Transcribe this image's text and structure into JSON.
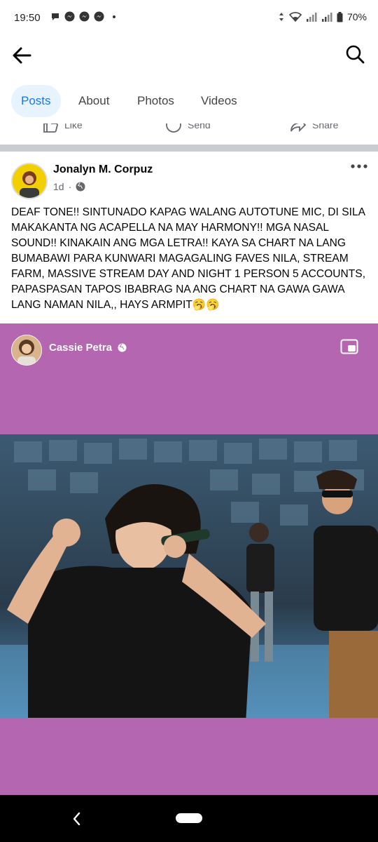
{
  "status_bar": {
    "time": "19:50",
    "battery": "70%",
    "icons": [
      "chat-bubble-icon",
      "messenger-icon",
      "messenger-icon",
      "messenger-icon",
      "dot-icon",
      "data-arrows-icon",
      "wifi-icon",
      "signal-icon",
      "signal-icon",
      "battery-icon"
    ]
  },
  "appbar": {
    "back_icon": "arrow-left-icon",
    "search_icon": "search-icon"
  },
  "tabs": [
    {
      "label": "Posts",
      "active": true
    },
    {
      "label": "About",
      "active": false
    },
    {
      "label": "Photos",
      "active": false
    },
    {
      "label": "Videos",
      "active": false
    }
  ],
  "actions": {
    "like": "Like",
    "send": "Send",
    "share": "Share"
  },
  "post": {
    "author": "Jonalyn M. Corpuz",
    "time": "1d",
    "audience_icon": "globe-icon",
    "text": "DEAF TONE!! SINTUNADO KAPAG WALANG AUTOTUNE MIC, DI SILA MAKAKANTA NG ACAPELLA NA MAY HARMONY!! MGA NASAL SOUND!! KINAKAIN ANG MGA LETRA!! KAYA SA CHART NA LANG BUMABAWI PARA KUNWARI MAGAGALING FAVES NILA, STREAM FARM, MASSIVE STREAM DAY AND NIGHT 1 PERSON 5 ACCOUNTS, PAPASPASAN TAPOS IBABRAG NA ANG CHART NA GAWA GAWA LANG NAMAN NILA,, HAYS ARMPIT🥱🥱"
  },
  "shared_post": {
    "author": "Cassie Petra",
    "audience_icon": "globe-icon",
    "background": "#b566b1"
  },
  "colors": {
    "accent": "#1877f2",
    "tab_active_bg": "#e7f3ff",
    "divider": "#c9ccd1"
  }
}
